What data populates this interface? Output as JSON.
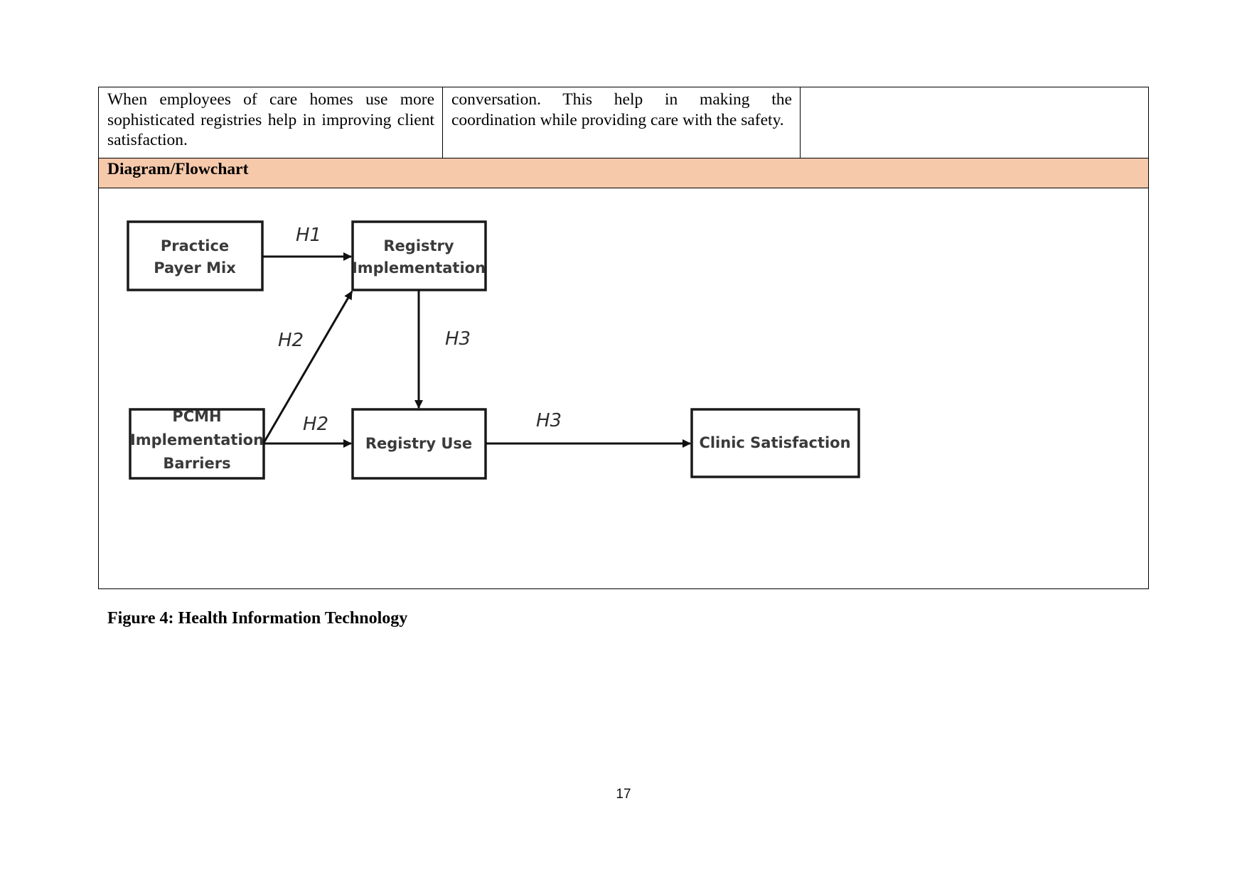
{
  "table": {
    "row1": {
      "col1": "When employees of care homes use more sophisticated registries help in improving client satisfaction.",
      "col2": "conversation. This help in making the coordination while providing care with the safety.",
      "col3": ""
    },
    "section_header": "Diagram/Flowchart",
    "section_header_color": "#f6c9ab"
  },
  "diagram": {
    "nodes": {
      "practice_payer_mix": [
        "Practice",
        "Payer Mix"
      ],
      "registry_implementation": [
        "Registry",
        "Implementation"
      ],
      "pcmh_barriers": [
        "PCMH",
        "Implementation",
        "Barriers"
      ],
      "registry_use": [
        "Registry Use"
      ],
      "clinic_satisfaction": [
        "Clinic Satisfaction"
      ]
    },
    "edges": [
      {
        "from": "Practice Payer Mix",
        "to": "Registry Implementation",
        "label": "H1"
      },
      {
        "from": "PCMH Implementation Barriers",
        "to": "Registry Implementation",
        "label": "H2"
      },
      {
        "from": "PCMH Implementation Barriers",
        "to": "Registry Use",
        "label": "H2"
      },
      {
        "from": "Registry Implementation",
        "to": "Registry Use",
        "label": "H3"
      },
      {
        "from": "Registry Use",
        "to": "Clinic Satisfaction",
        "label": "H3"
      }
    ]
  },
  "caption": "Figure 4: Health Information Technology",
  "page_number": "17"
}
